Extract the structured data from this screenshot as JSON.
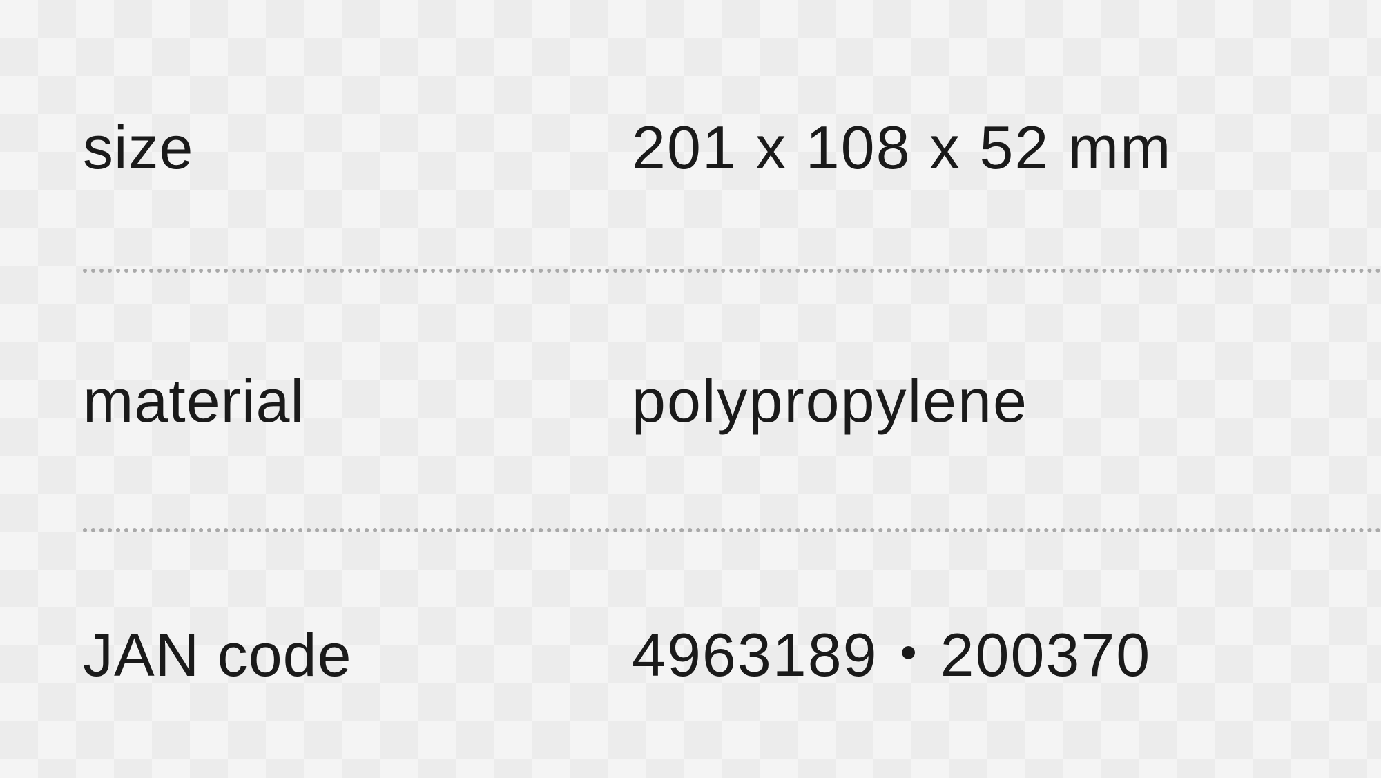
{
  "specs": {
    "rows": [
      {
        "label": "size",
        "value": "201 x 108 x 52 mm"
      },
      {
        "label": "material",
        "value": "polypropylene"
      },
      {
        "label": "JAN code",
        "value": "4963189・200370"
      }
    ]
  },
  "colors": {
    "text": "#1a1a1a",
    "divider": "#a9a9a9",
    "background": "#f4f4f4"
  }
}
